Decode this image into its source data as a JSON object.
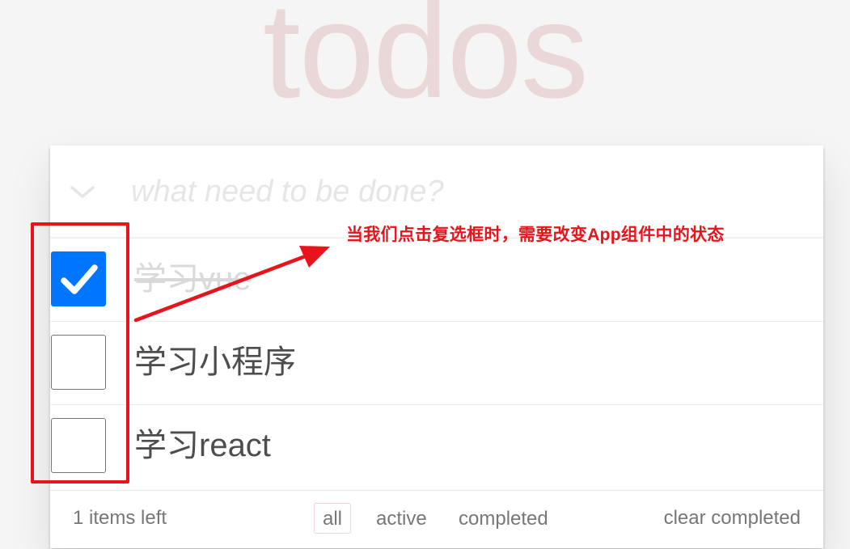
{
  "app": {
    "title": "todos"
  },
  "new_todo": {
    "placeholder": "what need to be done?",
    "toggle_all_icon": "chevron-down-icon"
  },
  "todos": [
    {
      "label": "学习vue",
      "completed": true
    },
    {
      "label": "学习小程序",
      "completed": false
    },
    {
      "label": "学习react",
      "completed": false
    }
  ],
  "footer": {
    "items_left": "1 items left",
    "filters": [
      "all",
      "active",
      "completed"
    ],
    "selected_filter": "all",
    "clear_completed": "clear completed"
  },
  "annotation": {
    "text": "当我们点击复选框时，需要改变App组件中的状态",
    "color": "#e8141c"
  },
  "colors": {
    "background": "#f5f5f5",
    "title": "rgba(175, 47, 47, 0.15)",
    "checkbox_checked": "#0075ff",
    "text": "#4d4d4d",
    "completed_text": "#d9d9d9"
  }
}
